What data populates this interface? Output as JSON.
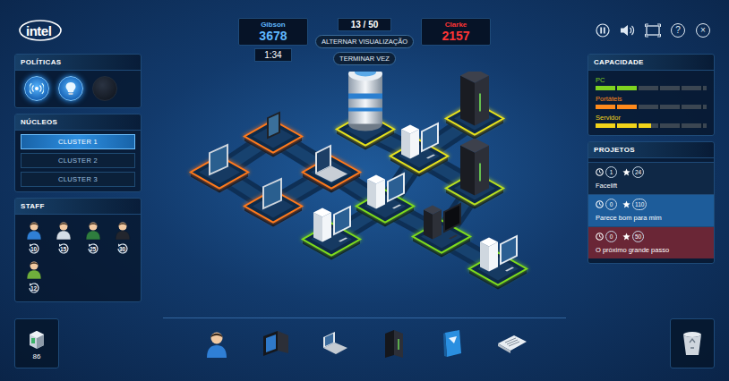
{
  "brand": {
    "logo": "intel"
  },
  "controls": [
    {
      "kind": "pause"
    },
    {
      "kind": "sound"
    },
    {
      "kind": "fullscreen"
    },
    {
      "kind": "help",
      "glyph": "?"
    },
    {
      "kind": "close",
      "glyph": "×"
    }
  ],
  "scoreboard": {
    "players": [
      {
        "name": "Gibson",
        "score": "3678",
        "color": "#5fb8ff"
      },
      {
        "name": "Clarke",
        "score": "2157",
        "color": "#ff3535"
      }
    ],
    "timer": "1:34",
    "turn": "13 / 50",
    "buttons": [
      "ALTERNAR VISUALIZAÇÃO",
      "TERMINAR VEZ"
    ]
  },
  "policies": {
    "title": "POLÍTICAS",
    "items": [
      {
        "kind": "signal",
        "selected": true
      },
      {
        "kind": "bulb",
        "selected": true
      },
      {
        "kind": "empty",
        "selected": false
      }
    ]
  },
  "cores": {
    "title": "NÚCLEOS",
    "items": [
      {
        "label": "CLUSTER 1",
        "selected": true
      },
      {
        "label": "CLUSTER 2",
        "selected": false
      },
      {
        "label": "CLUSTER 3",
        "selected": false
      }
    ]
  },
  "staff": {
    "title": "STAFF",
    "members": [
      {
        "count": "10",
        "color": "#2f7fd6"
      },
      {
        "count": "15",
        "color": "#d5dde6"
      },
      {
        "count": "25",
        "color": "#2e7d3e"
      },
      {
        "count": "30",
        "color": "#23262e"
      },
      {
        "count": "12",
        "color": "#6fae3c"
      }
    ]
  },
  "inventory": {
    "count": "86"
  },
  "toolbar": {
    "items": [
      {
        "kind": "person"
      },
      {
        "kind": "monitor"
      },
      {
        "kind": "laptop"
      },
      {
        "kind": "server"
      },
      {
        "kind": "book"
      },
      {
        "kind": "document"
      }
    ]
  },
  "board": {
    "tiles": [
      {
        "kind": "phone",
        "color": "#ff7a1a"
      },
      {
        "kind": "tablet",
        "color": "#ff7a1a"
      },
      {
        "kind": "laptop",
        "color": "#ff7a1a"
      },
      {
        "kind": "tablet",
        "color": "#ff7a1a"
      },
      {
        "kind": "cylinder",
        "color": "#e6e21e"
      },
      {
        "kind": "server",
        "color": "#e6e21e"
      },
      {
        "kind": "pc-white",
        "color": "#e6e21e"
      },
      {
        "kind": "server",
        "color": "#b8e020"
      },
      {
        "kind": "pc-white",
        "color": "#7edc1e"
      },
      {
        "kind": "pc-white",
        "color": "#7edc1e"
      },
      {
        "kind": "pc-black",
        "color": "#7edc1e"
      },
      {
        "kind": "pc-white",
        "color": "#7edc1e"
      }
    ]
  },
  "capacity": {
    "title": "CAPACIDADE",
    "bars": [
      {
        "label": "PC",
        "level": 0.37,
        "color": "#7fd320"
      },
      {
        "label": "Portáteis",
        "level": 0.37,
        "color": "#ff8a1c"
      },
      {
        "label": "Servidor",
        "level": 0.5,
        "color": "#f2d41a"
      }
    ]
  },
  "projects": {
    "title": "PROJETOS",
    "items": [
      {
        "name": "Facelift",
        "time": "1",
        "stars": "24",
        "color": "#0f2846"
      },
      {
        "name": "Parece bom para mim",
        "time": "0",
        "stars": "110",
        "color": "#1d5c9a"
      },
      {
        "name": "O próximo grande passo",
        "time": "0",
        "stars": "50",
        "color": "#6a2636"
      }
    ]
  }
}
